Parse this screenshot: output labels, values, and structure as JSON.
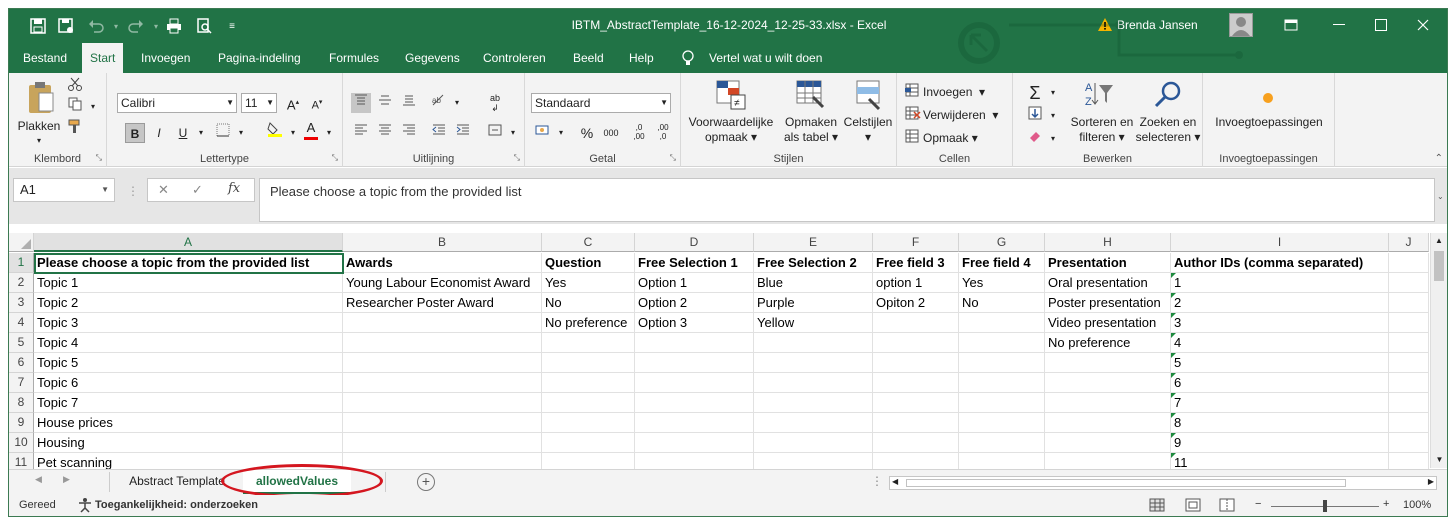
{
  "window": {
    "title": "IBTM_AbstractTemplate_16-12-2024_12-25-33.xlsx  -  Excel",
    "user": "Brenda Jansen",
    "warning_icon": "warning-icon"
  },
  "tabs": [
    "Bestand",
    "Start",
    "Invoegen",
    "Pagina-indeling",
    "Formules",
    "Gegevens",
    "Controleren",
    "Beeld",
    "Help"
  ],
  "active_tab": "Start",
  "tell_me": "Vertel wat u wilt doen",
  "ribbon": {
    "clipboard": {
      "paste": "Plakken",
      "label": "Klembord"
    },
    "font": {
      "name": "Calibri",
      "size": "11",
      "bold": "B",
      "italic": "I",
      "underline": "U",
      "label": "Lettertype"
    },
    "alignment": {
      "label": "Uitlijning"
    },
    "number": {
      "format": "Standaard",
      "percent": "%",
      "thousands": "000",
      "label": "Getal"
    },
    "styles": {
      "conditional": "Voorwaardelijke opmaak",
      "cond_line1": "Voorwaardelijke",
      "cond_line2": "opmaak",
      "table_line1": "Opmaken",
      "table_line2": "als tabel",
      "cellstyles": "Celstijlen",
      "label": "Stijlen"
    },
    "cells": {
      "insert": "Invoegen",
      "delete": "Verwijderen",
      "format": "Opmaak",
      "label": "Cellen"
    },
    "editing": {
      "sort_line1": "Sorteren en",
      "sort_line2": "filteren",
      "find_line1": "Zoeken en",
      "find_line2": "selecteren",
      "label": "Bewerken"
    },
    "addins": {
      "button": "Invoegtoepassingen",
      "label": "Invoegtoepassingen"
    }
  },
  "formula_bar": {
    "namebox": "A1",
    "content": "Please choose a topic from the provided list",
    "fx": "fx"
  },
  "columns": [
    "A",
    "B",
    "C",
    "D",
    "E",
    "F",
    "G",
    "H",
    "I",
    "J"
  ],
  "rows": [
    [
      "Please choose a topic from the provided list",
      "Awards",
      "Question",
      "Free Selection 1",
      "Free Selection 2",
      "Free field 3",
      "Free field 4",
      "Presentation",
      "Author IDs (comma separated)",
      ""
    ],
    [
      "Topic 1",
      "Young Labour Economist Award",
      "Yes",
      "Option 1",
      "Blue",
      "option 1",
      "Yes",
      "Oral presentation",
      "1",
      ""
    ],
    [
      "Topic 2",
      "Researcher Poster Award",
      "No",
      "Option 2",
      "Purple",
      "Opiton 2",
      "No",
      "Poster presentation",
      "2",
      ""
    ],
    [
      "Topic 3",
      "",
      "No preference",
      "Option 3",
      "Yellow",
      "",
      "",
      "Video presentation",
      "3",
      ""
    ],
    [
      "Topic 4",
      "",
      "",
      "",
      "",
      "",
      "",
      "No preference",
      "4",
      ""
    ],
    [
      "Topic 5",
      "",
      "",
      "",
      "",
      "",
      "",
      "",
      "5",
      ""
    ],
    [
      "Topic 6",
      "",
      "",
      "",
      "",
      "",
      "",
      "",
      "6",
      ""
    ],
    [
      "Topic 7",
      "",
      "",
      "",
      "",
      "",
      "",
      "",
      "7",
      ""
    ],
    [
      "House prices",
      "",
      "",
      "",
      "",
      "",
      "",
      "",
      "8",
      ""
    ],
    [
      "Housing",
      "",
      "",
      "",
      "",
      "",
      "",
      "",
      "9",
      ""
    ],
    [
      "Pet scanning",
      "",
      "",
      "",
      "",
      "",
      "",
      "",
      "11",
      ""
    ]
  ],
  "row_numbers": [
    "1",
    "2",
    "3",
    "4",
    "5",
    "6",
    "7",
    "8",
    "9",
    "10",
    "11"
  ],
  "sheets": [
    "Abstract Template",
    "allowedValues"
  ],
  "active_sheet": "allowedValues",
  "status": {
    "ready": "Gereed",
    "accessibility": "Toegankelijkheid: onderzoeken",
    "zoom": "100%"
  },
  "colors": {
    "brand": "#217346",
    "highlight": "#d4161f"
  }
}
